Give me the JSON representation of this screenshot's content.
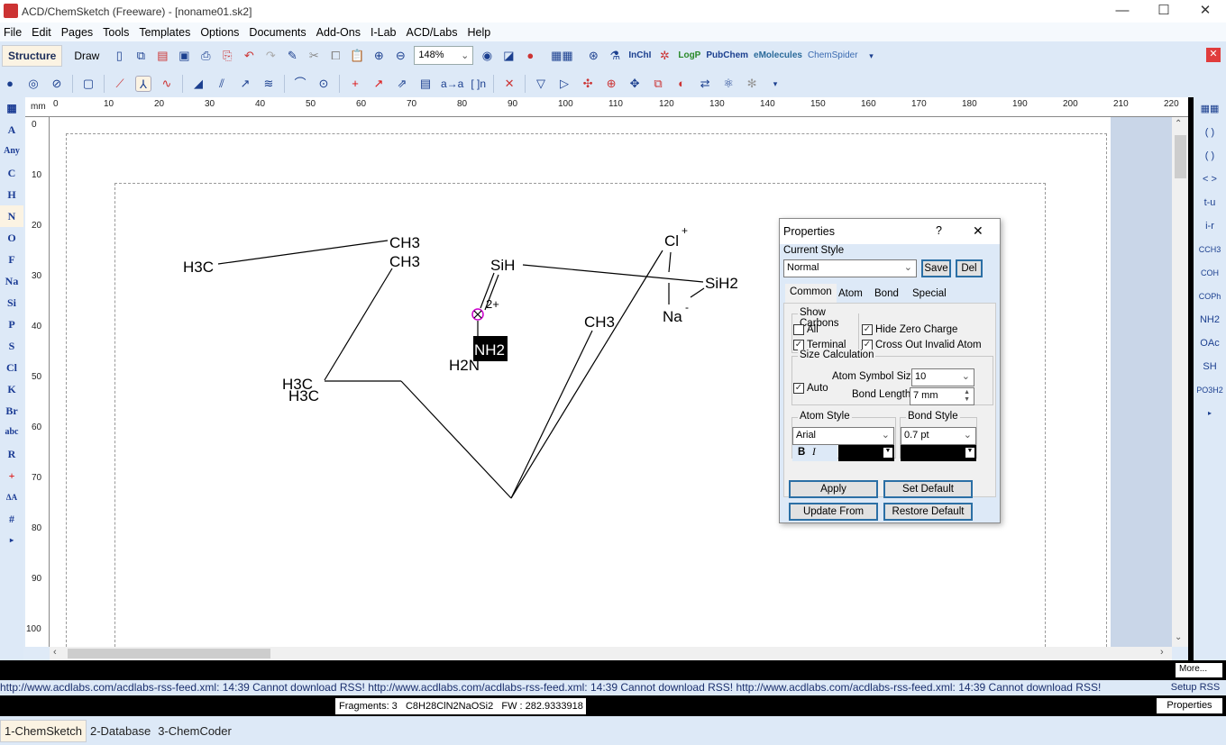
{
  "window": {
    "title": "ACD/ChemSketch (Freeware) - [noname01.sk2]",
    "minimize": "—",
    "maximize": "☐",
    "close": "✕"
  },
  "menu": [
    "File",
    "Edit",
    "Pages",
    "Tools",
    "Templates",
    "Options",
    "Documents",
    "Add-Ons",
    "I-Lab",
    "ACD/Labs",
    "Help"
  ],
  "toolbar": {
    "structure": "Structure",
    "draw": "Draw",
    "zoom": "148%",
    "inchi": "InChI",
    "logp": "LogP",
    "pubchem": "PubChem",
    "emolecules": "eMolecules",
    "chemspider": "ChemSpider",
    "aa": "a→a",
    "bracket": "[ ]n"
  },
  "ruler": {
    "unit": "mm",
    "top": [
      "0",
      "10",
      "20",
      "30",
      "40",
      "50",
      "60",
      "70",
      "80",
      "90",
      "100",
      "110",
      "120",
      "130",
      "140",
      "150",
      "160",
      "170",
      "180",
      "190",
      "200",
      "210",
      "220"
    ],
    "left": [
      "0",
      "10",
      "20",
      "30",
      "40",
      "50",
      "60",
      "70",
      "80",
      "90",
      "100"
    ]
  },
  "left_tools": [
    "A",
    "Any",
    "C",
    "H",
    "N",
    "O",
    "F",
    "Na",
    "Si",
    "P",
    "S",
    "Cl",
    "K",
    "Br",
    "abc",
    "R",
    "+",
    "ΔA",
    "#",
    "▸"
  ],
  "right_tools": [
    "▦▦",
    "( )",
    "( )",
    "< >",
    "t-u",
    "i-r",
    "CCH3",
    "COH",
    "COPh",
    "NH2",
    "OAc",
    "SH",
    "PO3H2",
    "▸"
  ],
  "molecule": {
    "labels": {
      "h3c_1": "H3C",
      "ch3_1": "CH3",
      "ch3_2": "CH3",
      "h3c_2": "H3C",
      "h3c_3": "H3C",
      "sih": "SiH",
      "charge_2plus": "2+",
      "nh2": "NH2",
      "h2n": "H2N",
      "ch3_3": "CH3",
      "cl": "Cl",
      "cl_charge": "+",
      "sih2": "SiH2",
      "na": "Na",
      "na_charge": "-"
    },
    "invalid_atom_color": "#cc00cc"
  },
  "properties": {
    "title": "Properties",
    "help": "?",
    "close": "✕",
    "current_style_label": "Current Style",
    "current_style": "Normal",
    "save": "Save",
    "del": "Del",
    "tabs": [
      "Common",
      "Atom",
      "Bond",
      "Special"
    ],
    "show_carbons": "Show Carbons",
    "all": "All",
    "all_checked": false,
    "terminal": "Terminal",
    "terminal_checked": true,
    "hide_zero_charge": "Hide Zero Charge",
    "hide_zero_checked": true,
    "cross_out": "Cross Out Invalid Atom",
    "cross_out_checked": true,
    "size_calc": "Size Calculation",
    "auto": "Auto",
    "auto_checked": true,
    "atom_symbol_size_label": "Atom Symbol Size",
    "atom_symbol_size": "10",
    "bond_length_label": "Bond Length",
    "bond_length": "7 mm",
    "atom_style": "Atom Style",
    "font": "Arial",
    "bold": "B",
    "italic": "I",
    "atom_color": "#000000",
    "bond_style": "Bond Style",
    "bond_width": "0.7 pt",
    "bond_color": "#000000",
    "apply": "Apply",
    "set_default": "Set Default",
    "update_from": "Update From",
    "restore_default": "Restore Default"
  },
  "more": "More...",
  "rss": {
    "text": "http://www.acdlabs.com/acdlabs-rss-feed.xml: 14:39 Cannot download RSS!",
    "setup": "Setup RSS"
  },
  "status": {
    "fragments": "Fragments: 3",
    "formula": "C8H28ClN2NaOSi2",
    "fw": "FW : 282.9333918",
    "properties": "Properties"
  },
  "bottom_tabs": [
    "1-ChemSketch",
    "2-Database",
    "3-ChemCoder"
  ]
}
